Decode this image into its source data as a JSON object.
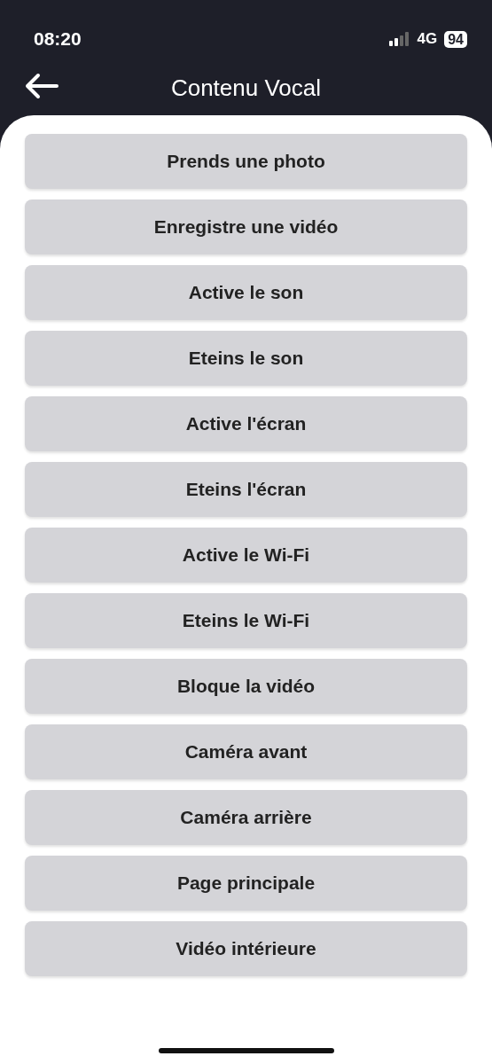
{
  "status_bar": {
    "time": "08:20",
    "network": "4G",
    "battery": "94"
  },
  "header": {
    "title": "Contenu Vocal"
  },
  "commands": [
    {
      "label": "Prends une photo"
    },
    {
      "label": "Enregistre une vidéo"
    },
    {
      "label": "Active le son"
    },
    {
      "label": "Eteins le son"
    },
    {
      "label": "Active l'écran"
    },
    {
      "label": "Eteins l'écran"
    },
    {
      "label": "Active le Wi-Fi"
    },
    {
      "label": "Eteins le Wi-Fi"
    },
    {
      "label": "Bloque la vidéo"
    },
    {
      "label": "Caméra avant"
    },
    {
      "label": "Caméra arrière"
    },
    {
      "label": "Page principale"
    },
    {
      "label": "Vidéo intérieure"
    }
  ]
}
